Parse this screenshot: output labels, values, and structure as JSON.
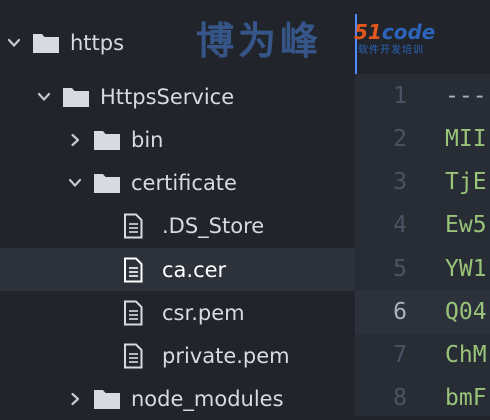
{
  "watermark": {
    "text": "博为峰",
    "logo_number": "51",
    "logo_word": "code",
    "logo_sub": "软件开发培训"
  },
  "file_tree": {
    "items": [
      {
        "label": "https",
        "type": "folder",
        "expanded": true
      },
      {
        "label": "HttpsService",
        "type": "folder",
        "expanded": true
      },
      {
        "label": "bin",
        "type": "folder",
        "expanded": false
      },
      {
        "label": "certificate",
        "type": "folder",
        "expanded": true
      },
      {
        "label": ".DS_Store",
        "type": "file"
      },
      {
        "label": "ca.cer",
        "type": "file",
        "selected": true
      },
      {
        "label": "csr.pem",
        "type": "file"
      },
      {
        "label": "private.pem",
        "type": "file"
      },
      {
        "label": "node_modules",
        "type": "folder",
        "expanded": false
      }
    ]
  },
  "editor": {
    "active_line": "6",
    "lines": [
      {
        "number": "1",
        "text": "---"
      },
      {
        "number": "2",
        "text": "MII"
      },
      {
        "number": "3",
        "text": "TjE"
      },
      {
        "number": "4",
        "text": "Ew5"
      },
      {
        "number": "5",
        "text": "YW1"
      },
      {
        "number": "6",
        "text": "Q04"
      },
      {
        "number": "7",
        "text": "ChM"
      },
      {
        "number": "8",
        "text": "bmF"
      }
    ]
  },
  "colors": {
    "sidebar_bg": "#21252b",
    "editor_bg": "#282c34",
    "selected_row": "#2c313a",
    "code_green": "#98c379",
    "accent": "#528bff"
  }
}
